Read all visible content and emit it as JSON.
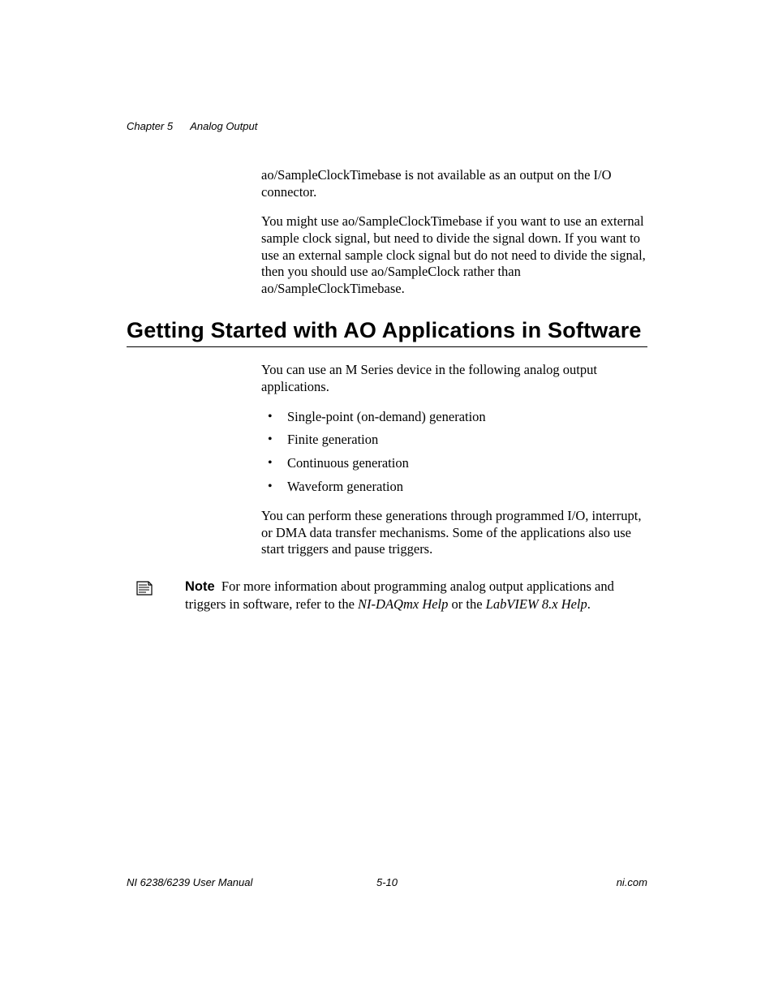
{
  "header": {
    "chapter": "Chapter 5",
    "title": "Analog Output"
  },
  "intro": {
    "p1": "ao/SampleClockTimebase is not available as an output on the I/O connector.",
    "p2": "You might use ao/SampleClockTimebase if you want to use an external sample clock signal, but need to divide the signal down. If you want to use an external sample clock signal but do not need to divide the signal, then you should use ao/SampleClock rather than ao/SampleClockTimebase."
  },
  "section": {
    "heading": "Getting Started with AO Applications in Software",
    "lead": "You can use an M Series device in the following analog output applications.",
    "bullets": [
      "Single-point (on-demand) generation",
      "Finite generation",
      "Continuous generation",
      "Waveform generation"
    ],
    "p_after": "You can perform these generations through programmed I/O, interrupt, or DMA data transfer mechanisms. Some of the applications also use start triggers and pause triggers."
  },
  "note": {
    "label": "Note",
    "text_before": "For more information about programming analog output applications and triggers in software, refer to the ",
    "ref1": "NI-DAQmx Help",
    "mid": " or the ",
    "ref2": "LabVIEW 8.x Help",
    "tail": "."
  },
  "footer": {
    "left": "NI 6238/6239 User Manual",
    "center": "5-10",
    "right": "ni.com"
  }
}
